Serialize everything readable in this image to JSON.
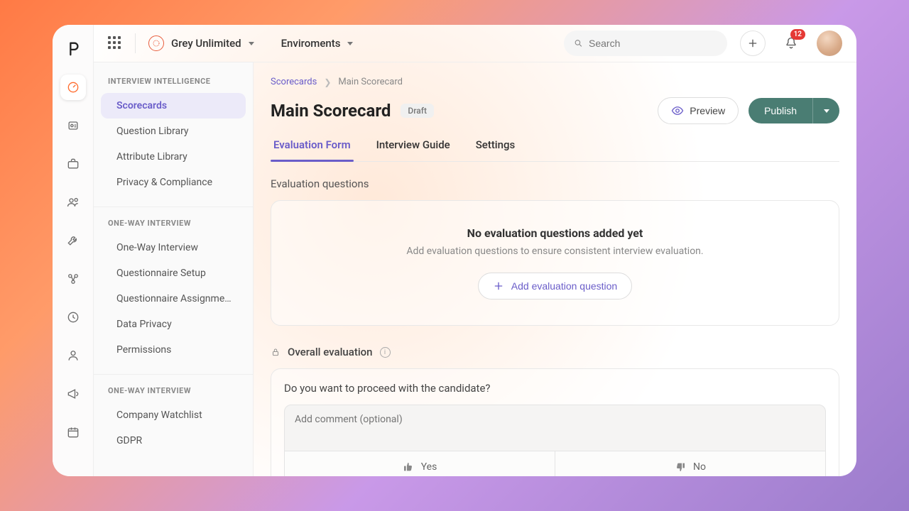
{
  "topbar": {
    "org_name": "Grey Unlimited",
    "env_label": "Enviroments",
    "search_placeholder": "Search",
    "notification_count": "12"
  },
  "sidebar": {
    "section1": {
      "title": "INTERVIEW INTELLIGENCE",
      "items": [
        "Scorecards",
        "Question Library",
        "Attribute Library",
        "Privacy & Compliance"
      ]
    },
    "section2": {
      "title": "ONE-WAY INTERVIEW",
      "items": [
        "One-Way Interview",
        "Questionnaire Setup",
        "Questionnaire Assignme…",
        "Data Privacy",
        "Permissions"
      ]
    },
    "section3": {
      "title": "ONE-WAY INTERVIEW",
      "items": [
        "Company Watchlist",
        "GDPR"
      ]
    }
  },
  "breadcrumb": {
    "root": "Scorecards",
    "current": "Main Scorecard"
  },
  "page": {
    "title": "Main Scorecard",
    "status": "Draft",
    "preview_label": "Preview",
    "publish_label": "Publish"
  },
  "tabs": [
    "Evaluation Form",
    "Interview Guide",
    "Settings"
  ],
  "evaluation": {
    "section_label": "Evaluation questions",
    "empty_title": "No evaluation questions added yet",
    "empty_sub": "Add evaluation questions to ensure consistent interview evaluation.",
    "add_label": "Add evaluation question"
  },
  "overall": {
    "label": "Overall evaluation",
    "question": "Do you want to proceed with the candidate?",
    "comment_placeholder": "Add comment (optional)",
    "yes_label": "Yes",
    "no_label": "No"
  }
}
